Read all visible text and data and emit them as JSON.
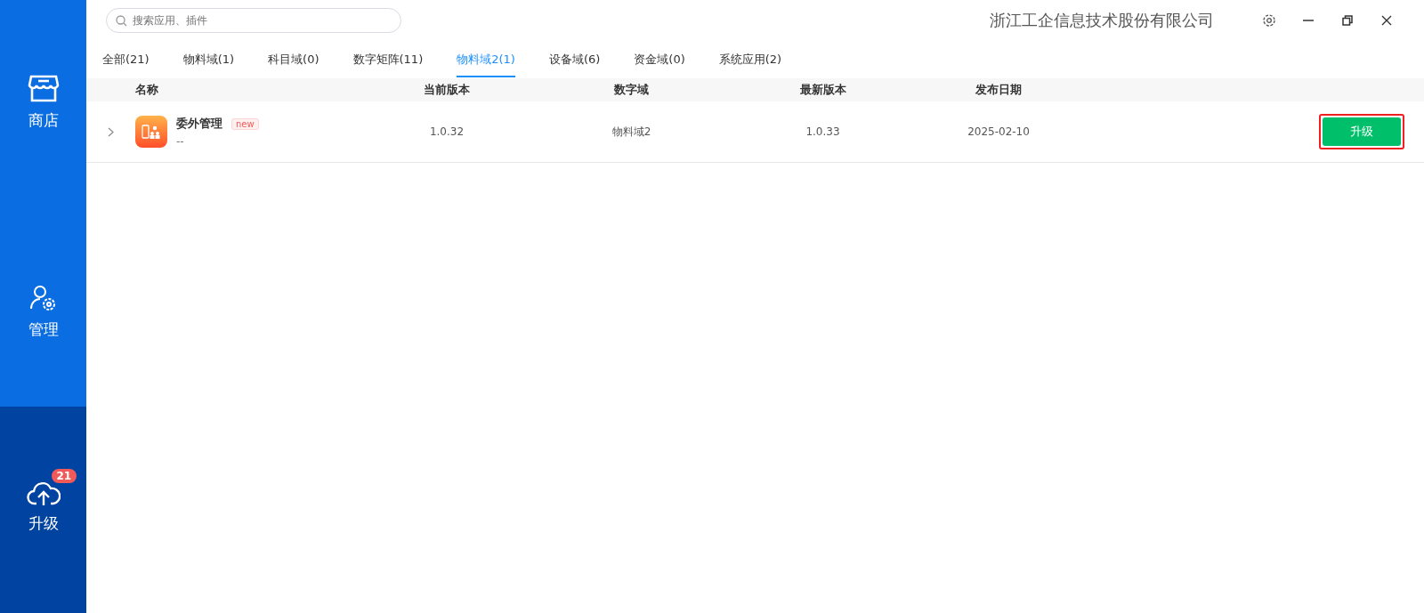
{
  "sidebar": {
    "items": [
      {
        "kind": "store",
        "label": "商店"
      },
      {
        "kind": "manage",
        "label": "管理"
      },
      {
        "kind": "upgrade",
        "label": "升级",
        "badge": "21"
      }
    ]
  },
  "search": {
    "placeholder": "搜索应用、插件"
  },
  "window": {
    "title": "浙江工企信息技术股份有限公司"
  },
  "tabs": [
    {
      "label": "全部(21)",
      "selected": false
    },
    {
      "label": "物料域(1)",
      "selected": false
    },
    {
      "label": "科目域(0)",
      "selected": false
    },
    {
      "label": "数字矩阵(11)",
      "selected": false
    },
    {
      "label": "物料域2(1)",
      "selected": true
    },
    {
      "label": "设备域(6)",
      "selected": false
    },
    {
      "label": "资金域(0)",
      "selected": false
    },
    {
      "label": "系统应用(2)",
      "selected": false
    }
  ],
  "table": {
    "columns": [
      "名称",
      "当前版本",
      "数字域",
      "最新版本",
      "发布日期"
    ],
    "rows": [
      {
        "name": "委外管理",
        "tag": "new",
        "description": "--",
        "current_version": "1.0.32",
        "domain": "物料域2",
        "latest_version": "1.0.33",
        "release_date": "2025-02-10",
        "action": "升级",
        "highlighted": true
      }
    ]
  }
}
